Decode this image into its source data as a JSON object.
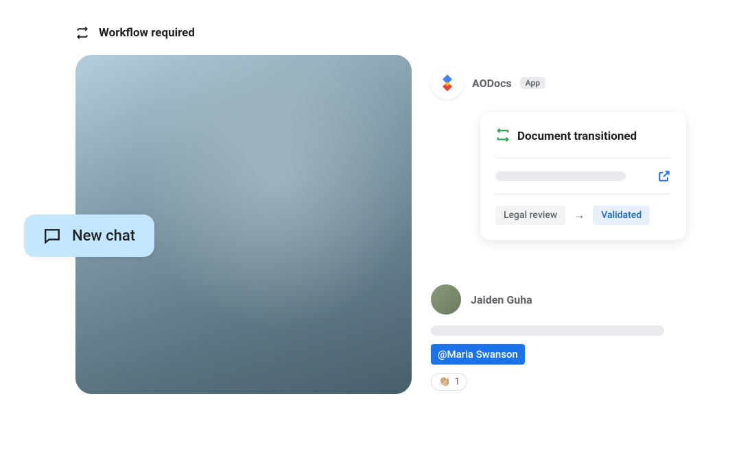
{
  "workflow": {
    "label": "Workflow required"
  },
  "chat": {
    "new_label": "New chat"
  },
  "app": {
    "name": "AODocs",
    "badge": "App"
  },
  "transition": {
    "title": "Document transitioned",
    "from": "Legal review",
    "to": "Validated"
  },
  "user": {
    "name": "Jaiden Guha",
    "mention": "@Maria Swanson",
    "reaction_emoji": "👏🏼",
    "reaction_count": "1"
  }
}
